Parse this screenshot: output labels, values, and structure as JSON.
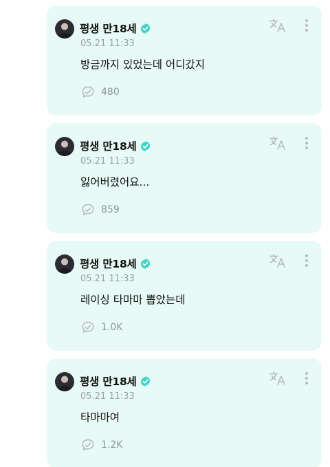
{
  "colors": {
    "card_background": "#e8faf6",
    "verified_badge": "#3fd4c8",
    "muted_text": "#9aa0a3",
    "icon": "#b9bec0"
  },
  "icons": {
    "verified": "verified-badge-icon",
    "translate": "translate-icon",
    "more": "more-vertical-icon",
    "reply": "reply-bubble-icon"
  },
  "posts": [
    {
      "author": "평생 만18세",
      "timestamp": "05.21 11:33",
      "message": "방금까지 있었는데 어디갔지",
      "reply_count": "480"
    },
    {
      "author": "평생 만18세",
      "timestamp": "05.21 11:33",
      "message": "잃어버렸어요...",
      "reply_count": "859"
    },
    {
      "author": "평생 만18세",
      "timestamp": "05.21 11:33",
      "message": "레이싱 타마마 뽑았는데",
      "reply_count": "1.0K"
    },
    {
      "author": "평생 만18세",
      "timestamp": "05.21 11:33",
      "message": "타마마여",
      "reply_count": "1.2K"
    }
  ]
}
